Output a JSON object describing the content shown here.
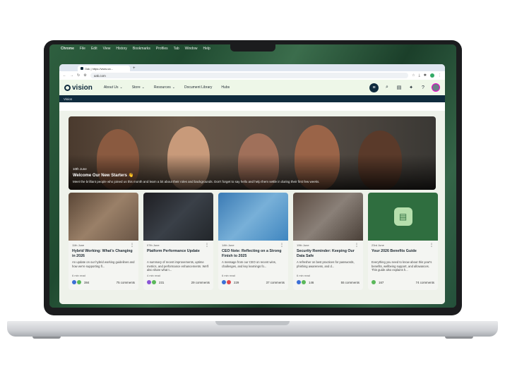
{
  "os_menubar": {
    "apple": "",
    "items": [
      "Chrome",
      "File",
      "Edit",
      "View",
      "History",
      "Bookmarks",
      "Profiles",
      "Tab",
      "Window",
      "Help"
    ]
  },
  "browser": {
    "tab_title": "Oak | https://www.oa...",
    "new_tab": "+",
    "url": "oak.com"
  },
  "site_nav": {
    "logo_text": "vision",
    "items": [
      {
        "label": "About Us",
        "chevron": true
      },
      {
        "label": "Store",
        "chevron": true
      },
      {
        "label": "Resources",
        "chevron": true
      },
      {
        "label": "Document Library",
        "chevron": false
      },
      {
        "label": "Hubs",
        "chevron": false
      }
    ],
    "icons": [
      "menu-icon",
      "search-icon",
      "chat-icon",
      "magic-wand-icon",
      "help-icon",
      "avatar"
    ]
  },
  "breadcrumb": "Vision",
  "hero": {
    "date": "10th June",
    "title": "Welcome Our New Starters 👋",
    "text": "Meet the brilliant people who joined us this month and learn a bit about their roles and backgrounds. Don't forget to say hello and help them settle in during their first few weeks."
  },
  "cards": [
    {
      "date": "11th June",
      "title": "Hybrid Working: What's Changing in 2026",
      "desc": "An update on our hybrid working guidelines and how we're supporting fl...",
      "read": "6 min read",
      "reactions": "384",
      "comments": "75 comments",
      "img": "#7a6450",
      "r1": "#3b6fd6",
      "r2": "#5bb85b"
    },
    {
      "date": "07th June",
      "title": "Platform Performance Update",
      "desc": "A summary of recent improvements, uptime metrics, and performance enhancements. We'll also share what t...",
      "read": "4 min read",
      "reactions": "231",
      "comments": "29 comments",
      "img": "#2c2c30",
      "r1": "#8a55d6",
      "r2": "#5bb85b"
    },
    {
      "date": "14th June",
      "title": "CEO Note: Reflecting on a Strong Finish to 2025",
      "desc": "A message from our CEO on recent wins, challenges, and key learnings fo...",
      "read": "6 min read",
      "reactions": "229",
      "comments": "37 comments",
      "img": "#4f8fc4",
      "r1": "#3b6fd6",
      "r2": "#e0484f"
    },
    {
      "date": "19th June",
      "title": "Security Reminder: Keeping Our Data Safe",
      "desc": "A refresher on best practices for passwords, phishing awareness, and d...",
      "read": "6 min read",
      "reactions": "146",
      "comments": "55 comments",
      "img": "#6f6258",
      "r1": "#3b6fd6",
      "r2": "#5bb85b"
    },
    {
      "date": "23rd June",
      "title": "Your 2026 Benefits Guide",
      "desc": "Everything you need to know about this year's benefits, wellbeing support, and allowances. This guide also explains h...",
      "read": "",
      "reactions": "167",
      "comments": "74 comments",
      "img": "#2f6e3f",
      "r1": "#5bb85b",
      "r2": ""
    }
  ]
}
